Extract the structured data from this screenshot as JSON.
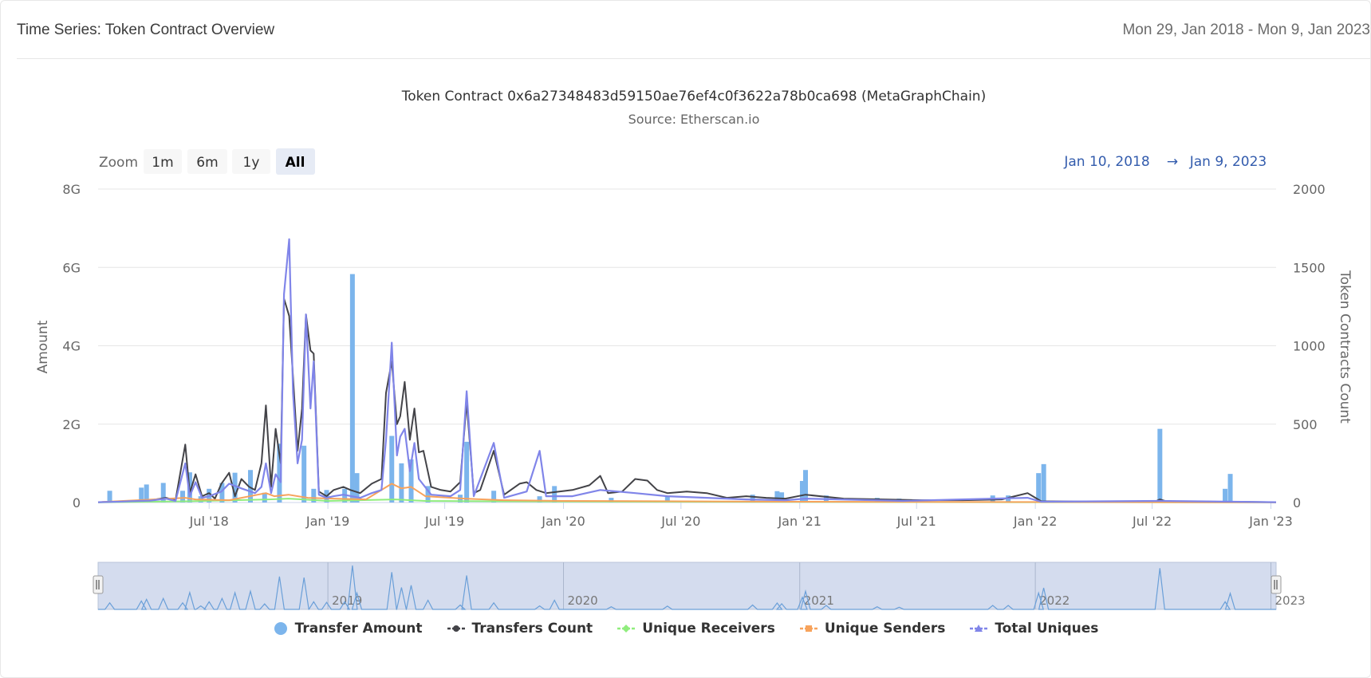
{
  "header": {
    "title": "Time Series: Token Contract Overview",
    "date_range": "Mon 29, Jan 2018 - Mon 9, Jan 2023"
  },
  "chart_data": {
    "type": "line",
    "title": "Token Contract 0x6a27348483d59150ae76ef4c0f3622a78b0ca698 (MetaGraphChain)",
    "subtitle": "Source: Etherscan.io",
    "range_selector": {
      "zoom_label": "Zoom",
      "buttons": [
        "1m",
        "6m",
        "1y",
        "All"
      ],
      "selected": "All",
      "from": "Jan 10, 2018",
      "arrow": "→",
      "to": "Jan 9, 2023"
    },
    "x_axis": {
      "type": "datetime",
      "min": "2018-01-10",
      "max": "2023-01-09",
      "ticks": [
        {
          "date": "2018-07-01",
          "label": "Jul '18"
        },
        {
          "date": "2019-01-01",
          "label": "Jan '19"
        },
        {
          "date": "2019-07-01",
          "label": "Jul '19"
        },
        {
          "date": "2020-01-01",
          "label": "Jan '20"
        },
        {
          "date": "2020-07-01",
          "label": "Jul '20"
        },
        {
          "date": "2021-01-01",
          "label": "Jan '21"
        },
        {
          "date": "2021-07-01",
          "label": "Jul '21"
        },
        {
          "date": "2022-01-01",
          "label": "Jan '22"
        },
        {
          "date": "2022-07-01",
          "label": "Jul '22"
        },
        {
          "date": "2023-01-01",
          "label": "Jan '23"
        }
      ]
    },
    "y_left": {
      "label": "Amount",
      "min": 0,
      "max": 8000000000,
      "ticks": [
        {
          "value": 0,
          "label": "0"
        },
        {
          "value": 2000000000,
          "label": "2G"
        },
        {
          "value": 4000000000,
          "label": "4G"
        },
        {
          "value": 6000000000,
          "label": "6G"
        },
        {
          "value": 8000000000,
          "label": "8G"
        }
      ]
    },
    "y_right": {
      "label": "Token Contracts Count",
      "min": 0,
      "max": 2000,
      "ticks": [
        {
          "value": 0,
          "label": "0"
        },
        {
          "value": 500,
          "label": "500"
        },
        {
          "value": 1000,
          "label": "1000"
        },
        {
          "value": 1500,
          "label": "1500"
        },
        {
          "value": 2000,
          "label": "2000"
        }
      ]
    },
    "grid": true,
    "legend_position": "bottom",
    "series": [
      {
        "name": "Transfer Amount",
        "kind": "column",
        "axis": "left",
        "color": "#7cb5ec",
        "legend_symbol": "circle",
        "points": [
          [
            "2018-01-28",
            300000000
          ],
          [
            "2018-03-18",
            380000000
          ],
          [
            "2018-03-26",
            460000000
          ],
          [
            "2018-04-21",
            500000000
          ],
          [
            "2018-05-21",
            300000000
          ],
          [
            "2018-06-01",
            770000000
          ],
          [
            "2018-06-18",
            160000000
          ],
          [
            "2018-07-01",
            350000000
          ],
          [
            "2018-07-21",
            500000000
          ],
          [
            "2018-08-10",
            760000000
          ],
          [
            "2018-09-03",
            830000000
          ],
          [
            "2018-09-25",
            250000000
          ],
          [
            "2018-10-18",
            1500000000
          ],
          [
            "2018-11-25",
            1450000000
          ],
          [
            "2018-12-10",
            350000000
          ],
          [
            "2018-12-30",
            320000000
          ],
          [
            "2019-01-27",
            350000000
          ],
          [
            "2019-02-08",
            5830000000
          ],
          [
            "2019-02-15",
            750000000
          ],
          [
            "2019-04-10",
            1700000000
          ],
          [
            "2019-04-25",
            1000000000
          ],
          [
            "2019-05-10",
            1100000000
          ],
          [
            "2019-06-05",
            420000000
          ],
          [
            "2019-07-25",
            200000000
          ],
          [
            "2019-08-04",
            1550000000
          ],
          [
            "2019-09-15",
            300000000
          ],
          [
            "2019-11-25",
            160000000
          ],
          [
            "2019-12-18",
            420000000
          ],
          [
            "2020-03-15",
            120000000
          ],
          [
            "2020-06-10",
            150000000
          ],
          [
            "2020-10-20",
            200000000
          ],
          [
            "2020-11-27",
            290000000
          ],
          [
            "2020-12-04",
            260000000
          ],
          [
            "2021-01-05",
            550000000
          ],
          [
            "2021-01-10",
            830000000
          ],
          [
            "2021-02-11",
            180000000
          ],
          [
            "2021-05-01",
            120000000
          ],
          [
            "2021-06-04",
            100000000
          ],
          [
            "2021-10-27",
            180000000
          ],
          [
            "2021-11-20",
            180000000
          ],
          [
            "2022-01-06",
            750000000
          ],
          [
            "2022-01-14",
            980000000
          ],
          [
            "2022-07-13",
            1880000000
          ],
          [
            "2022-10-22",
            350000000
          ],
          [
            "2022-10-30",
            730000000
          ]
        ]
      },
      {
        "name": "Transfers Count",
        "kind": "line",
        "axis": "right",
        "color": "#434348",
        "legend_symbol": "circle",
        "points": [
          [
            "2018-01-10",
            2
          ],
          [
            "2018-02-10",
            5
          ],
          [
            "2018-03-01",
            10
          ],
          [
            "2018-04-01",
            15
          ],
          [
            "2018-04-25",
            30
          ],
          [
            "2018-05-10",
            15
          ],
          [
            "2018-05-25",
            370
          ],
          [
            "2018-06-01",
            60
          ],
          [
            "2018-06-10",
            180
          ],
          [
            "2018-06-20",
            40
          ],
          [
            "2018-07-01",
            60
          ],
          [
            "2018-07-10",
            25
          ],
          [
            "2018-07-20",
            120
          ],
          [
            "2018-08-01",
            190
          ],
          [
            "2018-08-10",
            40
          ],
          [
            "2018-08-20",
            150
          ],
          [
            "2018-09-01",
            100
          ],
          [
            "2018-09-10",
            80
          ],
          [
            "2018-09-20",
            250
          ],
          [
            "2018-09-27",
            620
          ],
          [
            "2018-10-05",
            100
          ],
          [
            "2018-10-12",
            470
          ],
          [
            "2018-10-20",
            250
          ],
          [
            "2018-10-25",
            1300
          ],
          [
            "2018-11-02",
            1190
          ],
          [
            "2018-11-08",
            800
          ],
          [
            "2018-11-15",
            330
          ],
          [
            "2018-11-22",
            600
          ],
          [
            "2018-11-28",
            1200
          ],
          [
            "2018-12-05",
            970
          ],
          [
            "2018-12-10",
            950
          ],
          [
            "2018-12-18",
            70
          ],
          [
            "2018-12-30",
            40
          ],
          [
            "2019-01-10",
            80
          ],
          [
            "2019-01-25",
            100
          ],
          [
            "2019-02-05",
            80
          ],
          [
            "2019-02-20",
            60
          ],
          [
            "2019-03-10",
            120
          ],
          [
            "2019-03-25",
            150
          ],
          [
            "2019-04-01",
            700
          ],
          [
            "2019-04-10",
            900
          ],
          [
            "2019-04-18",
            500
          ],
          [
            "2019-04-23",
            550
          ],
          [
            "2019-04-30",
            770
          ],
          [
            "2019-05-08",
            400
          ],
          [
            "2019-05-15",
            600
          ],
          [
            "2019-05-22",
            320
          ],
          [
            "2019-05-29",
            330
          ],
          [
            "2019-06-10",
            100
          ],
          [
            "2019-06-25",
            80
          ],
          [
            "2019-07-10",
            70
          ],
          [
            "2019-07-25",
            130
          ],
          [
            "2019-08-04",
            640
          ],
          [
            "2019-08-15",
            60
          ],
          [
            "2019-08-25",
            80
          ],
          [
            "2019-09-15",
            330
          ],
          [
            "2019-10-01",
            50
          ],
          [
            "2019-10-25",
            120
          ],
          [
            "2019-11-05",
            130
          ],
          [
            "2019-11-20",
            80
          ],
          [
            "2019-12-05",
            60
          ],
          [
            "2020-01-15",
            80
          ],
          [
            "2020-02-10",
            110
          ],
          [
            "2020-02-27",
            170
          ],
          [
            "2020-03-10",
            60
          ],
          [
            "2020-04-01",
            70
          ],
          [
            "2020-04-21",
            150
          ],
          [
            "2020-05-10",
            140
          ],
          [
            "2020-05-25",
            80
          ],
          [
            "2020-06-10",
            60
          ],
          [
            "2020-07-10",
            70
          ],
          [
            "2020-08-10",
            60
          ],
          [
            "2020-09-10",
            30
          ],
          [
            "2020-10-10",
            40
          ],
          [
            "2020-11-10",
            30
          ],
          [
            "2020-12-10",
            25
          ],
          [
            "2021-01-10",
            50
          ],
          [
            "2021-03-10",
            25
          ],
          [
            "2021-05-10",
            20
          ],
          [
            "2021-07-10",
            15
          ],
          [
            "2021-09-10",
            15
          ],
          [
            "2021-11-10",
            20
          ],
          [
            "2021-12-20",
            60
          ],
          [
            "2022-01-10",
            8
          ],
          [
            "2022-04-10",
            5
          ],
          [
            "2022-07-05",
            5
          ],
          [
            "2022-07-13",
            20
          ],
          [
            "2022-07-25",
            5
          ],
          [
            "2022-10-30",
            5
          ],
          [
            "2023-01-09",
            2
          ]
        ]
      },
      {
        "name": "Unique Receivers",
        "kind": "line",
        "axis": "right",
        "color": "#90ed7d",
        "legend_symbol": "diamond",
        "points": [
          [
            "2018-01-10",
            1
          ],
          [
            "2018-06-01",
            8
          ],
          [
            "2018-10-01",
            20
          ],
          [
            "2018-11-01",
            25
          ],
          [
            "2019-01-01",
            10
          ],
          [
            "2019-04-15",
            20
          ],
          [
            "2019-06-01",
            10
          ],
          [
            "2019-09-01",
            8
          ],
          [
            "2020-01-01",
            6
          ],
          [
            "2020-06-01",
            5
          ],
          [
            "2021-01-01",
            4
          ],
          [
            "2021-06-01",
            3
          ],
          [
            "2022-01-01",
            2
          ],
          [
            "2023-01-09",
            1
          ]
        ]
      },
      {
        "name": "Unique Senders",
        "kind": "line",
        "axis": "right",
        "color": "#f7a35c",
        "legend_symbol": "square",
        "points": [
          [
            "2018-01-10",
            2
          ],
          [
            "2018-05-25",
            30
          ],
          [
            "2018-06-10",
            20
          ],
          [
            "2018-08-01",
            15
          ],
          [
            "2018-09-27",
            60
          ],
          [
            "2018-10-10",
            40
          ],
          [
            "2018-11-01",
            50
          ],
          [
            "2018-12-01",
            30
          ],
          [
            "2019-01-10",
            25
          ],
          [
            "2019-03-01",
            20
          ],
          [
            "2019-04-10",
            120
          ],
          [
            "2019-04-25",
            90
          ],
          [
            "2019-05-10",
            100
          ],
          [
            "2019-06-01",
            40
          ],
          [
            "2019-08-01",
            25
          ],
          [
            "2019-10-01",
            15
          ],
          [
            "2020-01-01",
            10
          ],
          [
            "2020-06-01",
            8
          ],
          [
            "2021-01-01",
            5
          ],
          [
            "2022-01-01",
            3
          ],
          [
            "2023-01-09",
            1
          ]
        ]
      },
      {
        "name": "Total Uniques",
        "kind": "line",
        "axis": "right",
        "color": "#8085e9",
        "legend_symbol": "triangle",
        "points": [
          [
            "2018-01-10",
            2
          ],
          [
            "2018-02-10",
            5
          ],
          [
            "2018-03-01",
            8
          ],
          [
            "2018-04-01",
            12
          ],
          [
            "2018-04-25",
            25
          ],
          [
            "2018-05-10",
            10
          ],
          [
            "2018-05-25",
            250
          ],
          [
            "2018-06-01",
            40
          ],
          [
            "2018-06-10",
            130
          ],
          [
            "2018-06-20",
            30
          ],
          [
            "2018-07-01",
            40
          ],
          [
            "2018-07-20",
            70
          ],
          [
            "2018-08-01",
            120
          ],
          [
            "2018-08-20",
            90
          ],
          [
            "2018-09-10",
            60
          ],
          [
            "2018-09-20",
            100
          ],
          [
            "2018-09-27",
            250
          ],
          [
            "2018-10-05",
            60
          ],
          [
            "2018-10-12",
            180
          ],
          [
            "2018-10-20",
            130
          ],
          [
            "2018-10-25",
            1330
          ],
          [
            "2018-11-02",
            1680
          ],
          [
            "2018-11-08",
            700
          ],
          [
            "2018-11-15",
            250
          ],
          [
            "2018-11-22",
            400
          ],
          [
            "2018-11-28",
            1200
          ],
          [
            "2018-12-05",
            600
          ],
          [
            "2018-12-10",
            900
          ],
          [
            "2018-12-18",
            50
          ],
          [
            "2018-12-30",
            30
          ],
          [
            "2019-01-10",
            40
          ],
          [
            "2019-01-25",
            50
          ],
          [
            "2019-02-20",
            30
          ],
          [
            "2019-03-10",
            60
          ],
          [
            "2019-03-25",
            80
          ],
          [
            "2019-04-01",
            400
          ],
          [
            "2019-04-10",
            1020
          ],
          [
            "2019-04-18",
            300
          ],
          [
            "2019-04-23",
            420
          ],
          [
            "2019-04-30",
            470
          ],
          [
            "2019-05-08",
            200
          ],
          [
            "2019-05-15",
            380
          ],
          [
            "2019-05-22",
            150
          ],
          [
            "2019-06-10",
            50
          ],
          [
            "2019-07-10",
            40
          ],
          [
            "2019-07-25",
            80
          ],
          [
            "2019-08-04",
            710
          ],
          [
            "2019-08-15",
            40
          ],
          [
            "2019-09-15",
            380
          ],
          [
            "2019-10-01",
            30
          ],
          [
            "2019-11-05",
            70
          ],
          [
            "2019-11-25",
            330
          ],
          [
            "2019-12-05",
            40
          ],
          [
            "2020-01-15",
            40
          ],
          [
            "2020-02-27",
            80
          ],
          [
            "2020-04-21",
            60
          ],
          [
            "2020-06-10",
            40
          ],
          [
            "2020-08-10",
            30
          ],
          [
            "2020-10-10",
            20
          ],
          [
            "2020-12-10",
            15
          ],
          [
            "2021-01-10",
            25
          ],
          [
            "2021-06-10",
            10
          ],
          [
            "2021-12-20",
            30
          ],
          [
            "2022-01-10",
            5
          ],
          [
            "2022-07-13",
            10
          ],
          [
            "2023-01-09",
            2
          ]
        ]
      }
    ],
    "navigator": {
      "year_labels": [
        {
          "date": "2019-01-01",
          "label": "2019"
        },
        {
          "date": "2020-01-01",
          "label": "2020"
        },
        {
          "date": "2021-01-01",
          "label": "2021"
        },
        {
          "date": "2022-01-01",
          "label": "2022"
        },
        {
          "date": "2023-01-01",
          "label": "2023"
        }
      ]
    }
  }
}
